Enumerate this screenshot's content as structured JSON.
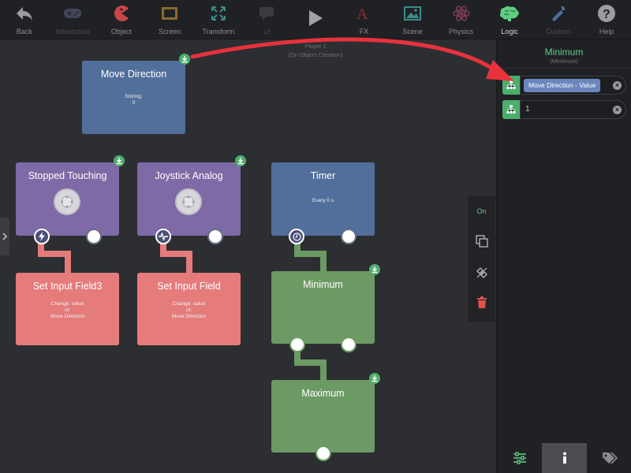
{
  "toolbar": {
    "items": [
      {
        "label": "Back",
        "icon": "back-arrow-icon",
        "state": "enabled"
      },
      {
        "label": "Interaction",
        "icon": "gamepad-icon",
        "state": "disabled"
      },
      {
        "label": "Object",
        "icon": "pacman-icon",
        "state": "enabled"
      },
      {
        "label": "Screen",
        "icon": "screen-icon",
        "state": "enabled"
      },
      {
        "label": "Transform",
        "icon": "transform-icon",
        "state": "enabled"
      },
      {
        "label": "UI",
        "icon": "speech-bubble-icon",
        "state": "disabled"
      },
      {
        "label": "",
        "icon": "play-icon",
        "state": "enabled"
      },
      {
        "label": "FX",
        "icon": "fx-icon",
        "state": "enabled"
      },
      {
        "label": "Scene",
        "icon": "scene-image-icon",
        "state": "enabled"
      },
      {
        "label": "Physics",
        "icon": "atom-icon",
        "state": "enabled"
      },
      {
        "label": "Logic",
        "icon": "brain-icon",
        "state": "active"
      },
      {
        "label": "Custom",
        "icon": "wrench-icon",
        "state": "disabled"
      },
      {
        "label": "Help",
        "icon": "question-icon",
        "state": "enabled"
      }
    ]
  },
  "canvas": {
    "header_line1": "Player 1",
    "header_line2": "(On Object Creation)",
    "nodes": {
      "move_direction": {
        "title": "Move Direction",
        "line1": "Storing:",
        "line2": "0"
      },
      "stopped_touching": {
        "title": "Stopped Touching"
      },
      "joystick_analog": {
        "title": "Joystick Analog"
      },
      "timer": {
        "title": "Timer",
        "line1": "Every 0 s"
      },
      "set_input_field3": {
        "title": "Set Input Field3",
        "line1": "Change: value",
        "line2": "of:",
        "line3": "Move Direction"
      },
      "set_input_field": {
        "title": "Set Input Field",
        "line1": "Change: value",
        "line2": "of:",
        "line3": "Move Direction"
      },
      "minimum": {
        "title": "Minimum"
      },
      "maximum": {
        "title": "Maximum"
      }
    }
  },
  "side_tools": {
    "on_label": "On"
  },
  "panel": {
    "title": "Minimum",
    "subtitle": "(Minimum)",
    "params": [
      {
        "value": "Move Direction - Value",
        "type": "chip"
      },
      {
        "value": "1",
        "type": "text"
      }
    ]
  },
  "colors": {
    "accent_green": "#5ecf82",
    "node_blue": "#526e9a",
    "node_purple": "#7d6aa6",
    "node_red": "#e57b7b",
    "node_green": "#6c9a64",
    "annotation_arrow": "#e8323c"
  }
}
